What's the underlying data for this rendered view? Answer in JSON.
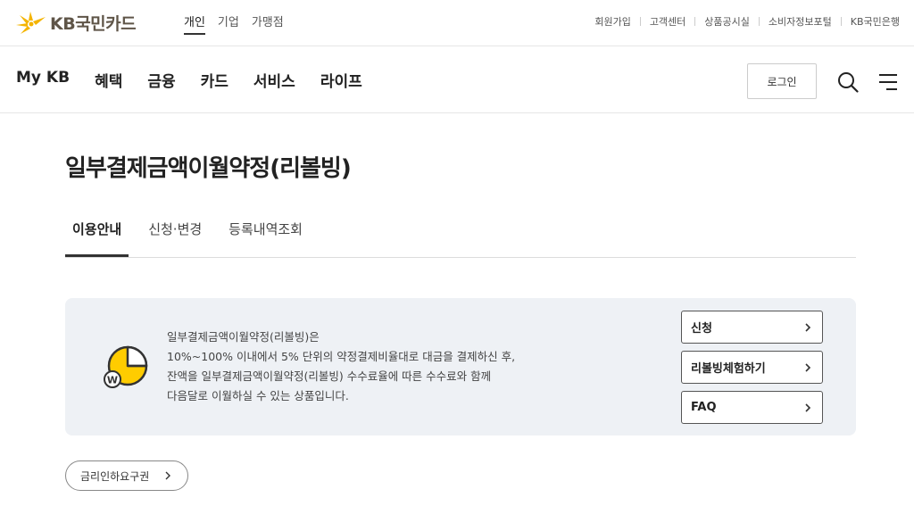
{
  "brand": {
    "logo_text": "KB국민카드"
  },
  "segments": [
    {
      "label": "개인",
      "active": true
    },
    {
      "label": "기업",
      "active": false
    },
    {
      "label": "가맹점",
      "active": false
    }
  ],
  "utility_links": [
    "회원가입",
    "고객센터",
    "상품공시실",
    "소비자정보포털",
    "KB국민은행"
  ],
  "nav": [
    {
      "label": "My KB",
      "active": false
    },
    {
      "label": "혜택",
      "active": false
    },
    {
      "label": "금융",
      "active": true
    },
    {
      "label": "카드",
      "active": false
    },
    {
      "label": "서비스",
      "active": false
    },
    {
      "label": "라이프",
      "active": false
    }
  ],
  "header": {
    "login_label": "로그인",
    "search_icon": "search-icon",
    "menu_icon": "hamburger-menu-icon"
  },
  "page": {
    "title": "일부결제금액이월약정(리볼빙)"
  },
  "tabs": [
    {
      "label": "이용안내",
      "active": true
    },
    {
      "label": "신청·변경",
      "active": false
    },
    {
      "label": "등록내역조회",
      "active": false
    }
  ],
  "info": {
    "lines": [
      "일부결제금액이월약정(리볼빙)은",
      "10%~100% 이내에서 5% 단위의 약정결제비율대로 대금을 결제하신 후,",
      "잔액을 일부결제금액이월약정(리볼빙) 수수료율에 따른 수수료와 함께",
      "다음달로 이월하실 수 있는 상품입니다."
    ],
    "icon_mark": "W",
    "actions": [
      "신청",
      "리볼빙체험하기",
      "FAQ"
    ]
  },
  "rate_button": {
    "label": "금리인하요구권"
  },
  "colors": {
    "accent": "#ffcc00",
    "box_bg": "#eef1f5"
  }
}
